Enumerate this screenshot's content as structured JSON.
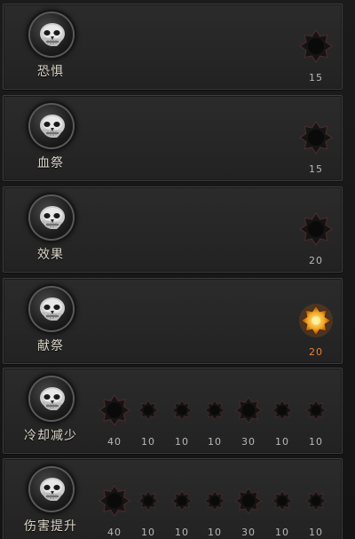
{
  "skills": [
    {
      "name": "恐惧",
      "runes": [
        {
          "value": "15",
          "active": false
        }
      ]
    },
    {
      "name": "血祭",
      "runes": [
        {
          "value": "15",
          "active": false
        }
      ]
    },
    {
      "name": "效果",
      "runes": [
        {
          "value": "20",
          "active": false
        }
      ]
    },
    {
      "name": "献祭",
      "runes": [
        {
          "value": "20",
          "active": true
        }
      ]
    },
    {
      "name": "冷却减少",
      "runes": [
        {
          "value": "40",
          "active": false,
          "size": "large"
        },
        {
          "value": "10",
          "active": false,
          "size": "small"
        },
        {
          "value": "10",
          "active": false,
          "size": "small"
        },
        {
          "value": "10",
          "active": false,
          "size": "small"
        },
        {
          "value": "30",
          "active": false,
          "size": "medium"
        },
        {
          "value": "10",
          "active": false,
          "size": "small"
        },
        {
          "value": "10",
          "active": false,
          "size": "small"
        }
      ]
    },
    {
      "name": "伤害提升",
      "runes": [
        {
          "value": "40",
          "active": false,
          "size": "large"
        },
        {
          "value": "10",
          "active": false,
          "size": "small"
        },
        {
          "value": "10",
          "active": false,
          "size": "small"
        },
        {
          "value": "10",
          "active": false,
          "size": "small"
        },
        {
          "value": "30",
          "active": false,
          "size": "medium"
        },
        {
          "value": "10",
          "active": false,
          "size": "small"
        },
        {
          "value": "10",
          "active": false,
          "size": "small"
        }
      ]
    }
  ],
  "icons": {
    "skill": "skull-icon",
    "rune": "rune-star-icon"
  },
  "colors": {
    "rune_inactive_fill": "#141414",
    "rune_inactive_rim": "#4a2a2a",
    "rune_active_fill": "#f2a623",
    "rune_active_core": "#fff2a0",
    "value_active": "#e8813a",
    "value_inactive": "#b8b8b8"
  }
}
